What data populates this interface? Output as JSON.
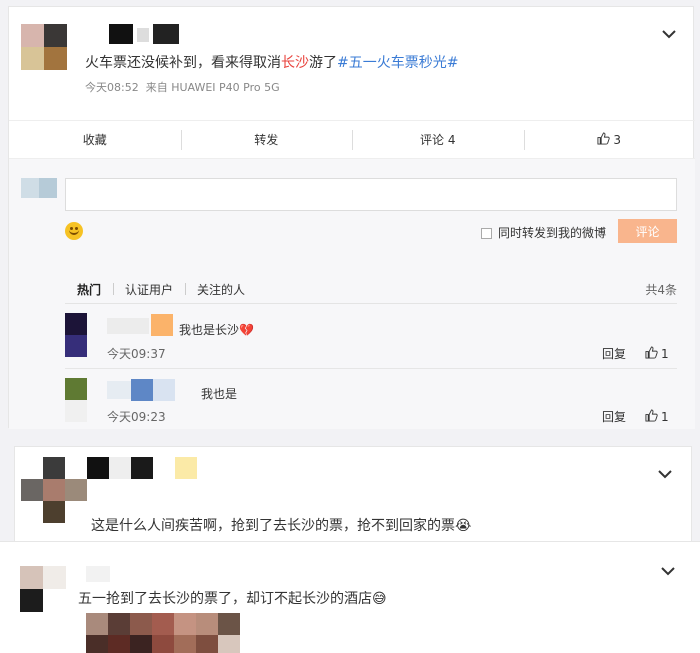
{
  "post": {
    "text_a": "火车票还没候补到，看来得取消",
    "text_place": "长沙",
    "text_b": "游了",
    "hashtag": "#五一火车票秒光#",
    "timestamp": "今天08:52",
    "source": "来自 HUAWEI P40 Pro 5G",
    "actions": {
      "collect": "收藏",
      "forward": "转发",
      "comment": "评论 4",
      "like_count": "3"
    }
  },
  "composer": {
    "input_placeholder": "",
    "repost_label": "同时转发到我的微博",
    "submit_label": "评论"
  },
  "filters": {
    "hot": "热门",
    "verified": "认证用户",
    "following": "关注的人",
    "total": "共4条"
  },
  "comments": [
    {
      "text": "我也是长沙",
      "emoji": "💔",
      "time": "今天09:37",
      "reply": "回复",
      "likes": "1"
    },
    {
      "text": "我也是",
      "time": "今天09:23",
      "reply": "回复",
      "likes": "1"
    }
  ],
  "post2": {
    "text": "这是什么人间疾苦啊，抢到了去长沙的票，抢不到回家的票",
    "emoji": "😭"
  },
  "post3": {
    "text": "五一抢到了去长沙的票了，却订不起长沙的酒店",
    "emoji": "😅"
  },
  "colors": {
    "accent_red": "#e8423c",
    "link_blue": "#3a7bd5",
    "submit_disabled": "#f9b58d"
  },
  "icons": {
    "more": "chevron-down-icon",
    "like": "thumb-up-icon",
    "emoji": "smile-icon"
  }
}
